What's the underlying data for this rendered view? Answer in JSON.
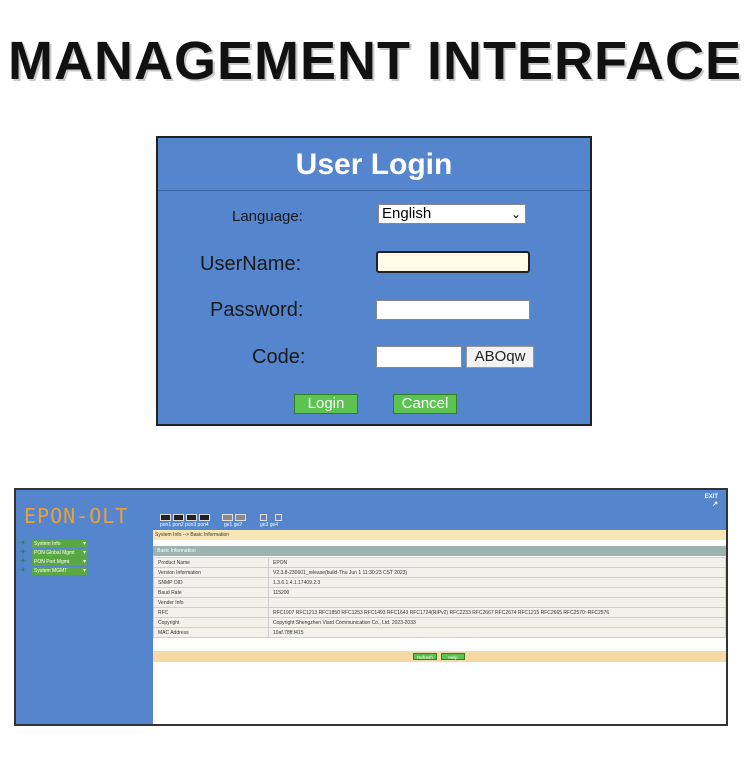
{
  "headline": "MANAGEMENT INTERFACE",
  "login": {
    "title": "User Login",
    "language_label": "Language:",
    "language_value": "English",
    "username_label": "UserName:",
    "password_label": "Password:",
    "code_label": "Code:",
    "captcha": "ABOqw",
    "login_button": "Login",
    "cancel_button": "Cancel"
  },
  "epon": {
    "logo": "EPON-OLT",
    "exit": "EXIT",
    "ports": {
      "pon_labels": "pon1 pon2 pon3 pon4",
      "ge_labels_1": "ge1  ge2",
      "ge_labels_2": "ge3  ge4"
    },
    "nav": [
      {
        "label": "System Info"
      },
      {
        "label": "PON Global Mgmt"
      },
      {
        "label": "PON Port Mgmt"
      },
      {
        "label": "System MGMT"
      }
    ],
    "breadcrumb": "System Info --> Basic Information",
    "section_title": "Basic Information",
    "rows": [
      {
        "key": "Product Name",
        "value": "EPON"
      },
      {
        "key": "Version Information",
        "value": "V2.3.8-230601_release(build-Thu Jun 1 11:30:23 CST 2023)"
      },
      {
        "key": "SNMP OID",
        "value": "1.3.6.1.4.1.17409.2.3"
      },
      {
        "key": "Baud Rate",
        "value": "115200"
      },
      {
        "key": "Vender Info",
        "value": ""
      },
      {
        "key": "RFC",
        "value": "RFC1907 RFC1213 RFC1850 RFC1253 RFC1493 RFC1643 RFC1724(RIPv2) RFC2233 RFC2667 RFC2674 RFC1215 RFC2665 RFC2570~RFC2576"
      },
      {
        "key": "Copyright",
        "value": "Copyright Shengzhen Viard Communication Co., Ltd. 2023-2033"
      },
      {
        "key": "MAC Address",
        "value": "10af.78ff.f415"
      }
    ],
    "refresh_button": "Refresh",
    "help_button": "Help"
  }
}
